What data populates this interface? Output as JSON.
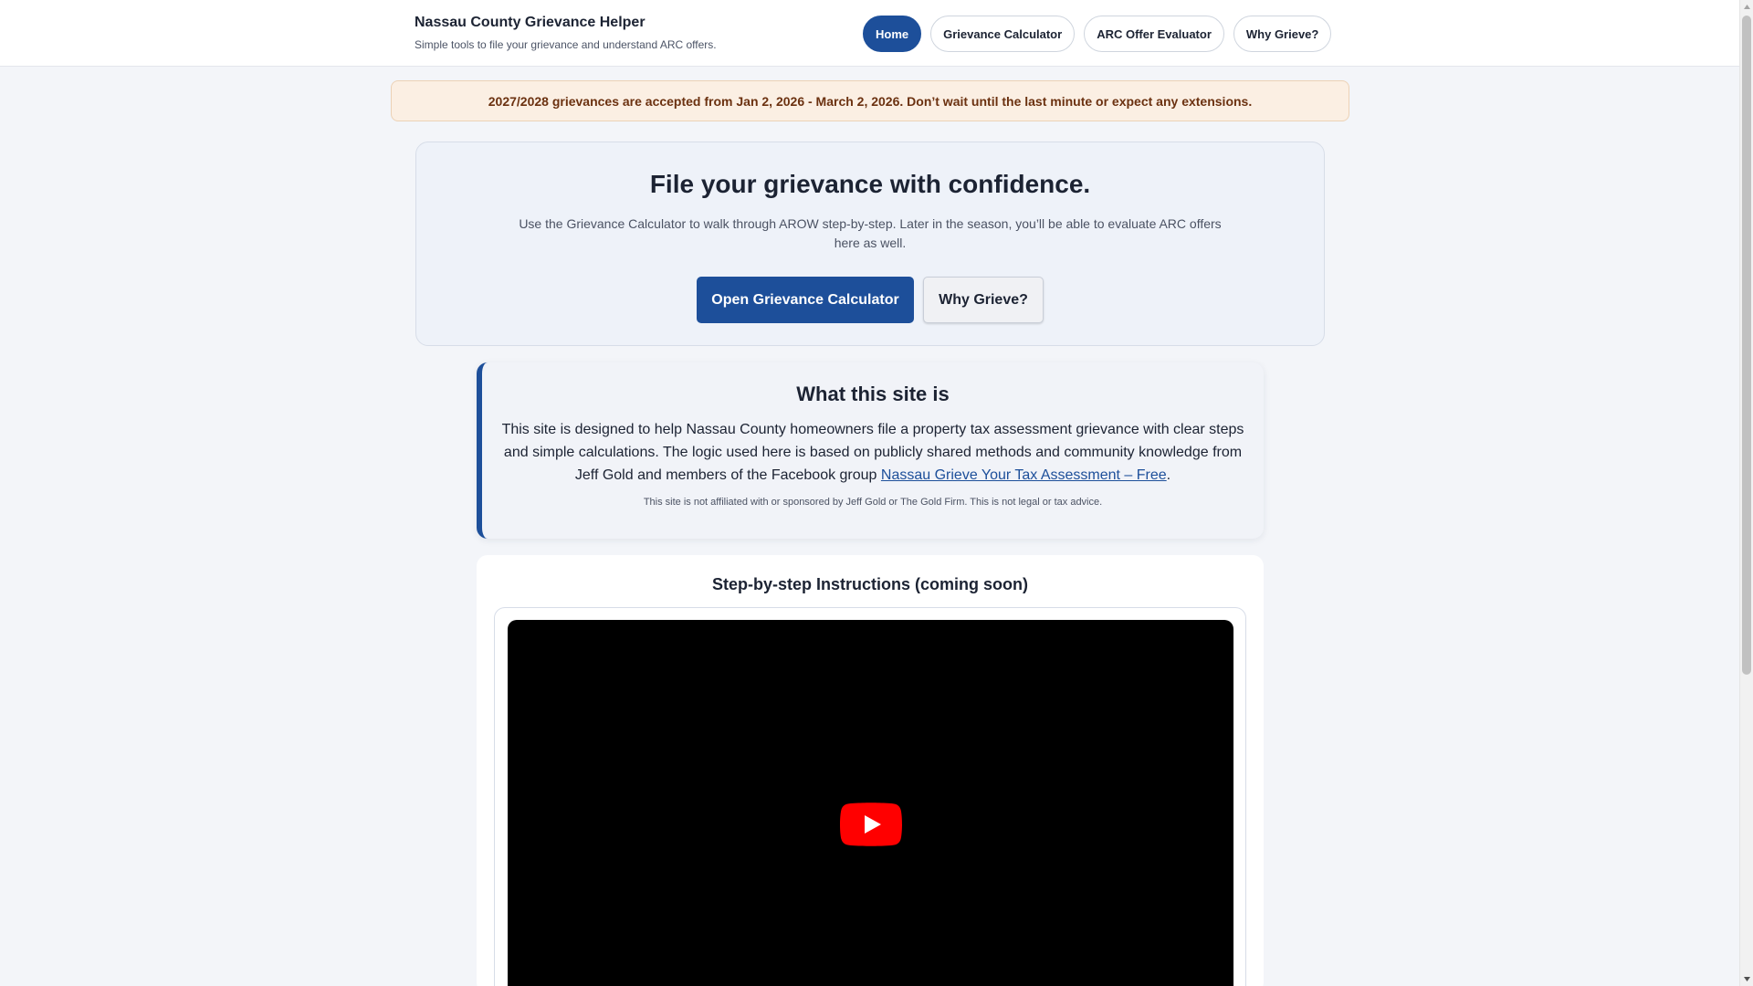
{
  "header": {
    "title": "Nassau County Grievance Helper",
    "subtitle": "Simple tools to file your grievance and understand ARC offers.",
    "nav": [
      {
        "label": "Home",
        "active": true
      },
      {
        "label": "Grievance Calculator",
        "active": false
      },
      {
        "label": "ARC Offer Evaluator",
        "active": false
      },
      {
        "label": "Why Grieve?",
        "active": false
      }
    ]
  },
  "notice": {
    "text": "2027/2028 grievances are accepted from Jan 2, 2026 - March 2, 2026. Don’t wait until the last minute or expect any extensions."
  },
  "hero": {
    "heading": "File your grievance with confidence.",
    "description": "Use the Grievance Calculator to walk through AROW step-by-step. Later in the season, you’ll be able to evaluate ARC offers here as well.",
    "primary_button": "Open Grievance Calculator",
    "secondary_button": "Why Grieve?"
  },
  "about": {
    "heading": "What this site is",
    "body_before_link": "This site is designed to help Nassau County homeowners file a property tax assessment grievance with clear steps and simple calculations. The logic used here is based on publicly shared methods and community knowledge from Jeff Gold and members of the Facebook group ",
    "link_text": "Nassau Grieve Your Tax Assessment – Free",
    "body_after_link": ".",
    "disclaimer": "This site is not affiliated with or sponsored by Jeff Gold or The Gold Firm. This is not legal or tax advice."
  },
  "video_section": {
    "heading": "Step-by-step Instructions (coming soon)"
  },
  "colors": {
    "accent": "#1d4f9a",
    "notice_bg": "#fbefe3",
    "notice_text": "#6b3110",
    "play_red": "#ff0000"
  }
}
